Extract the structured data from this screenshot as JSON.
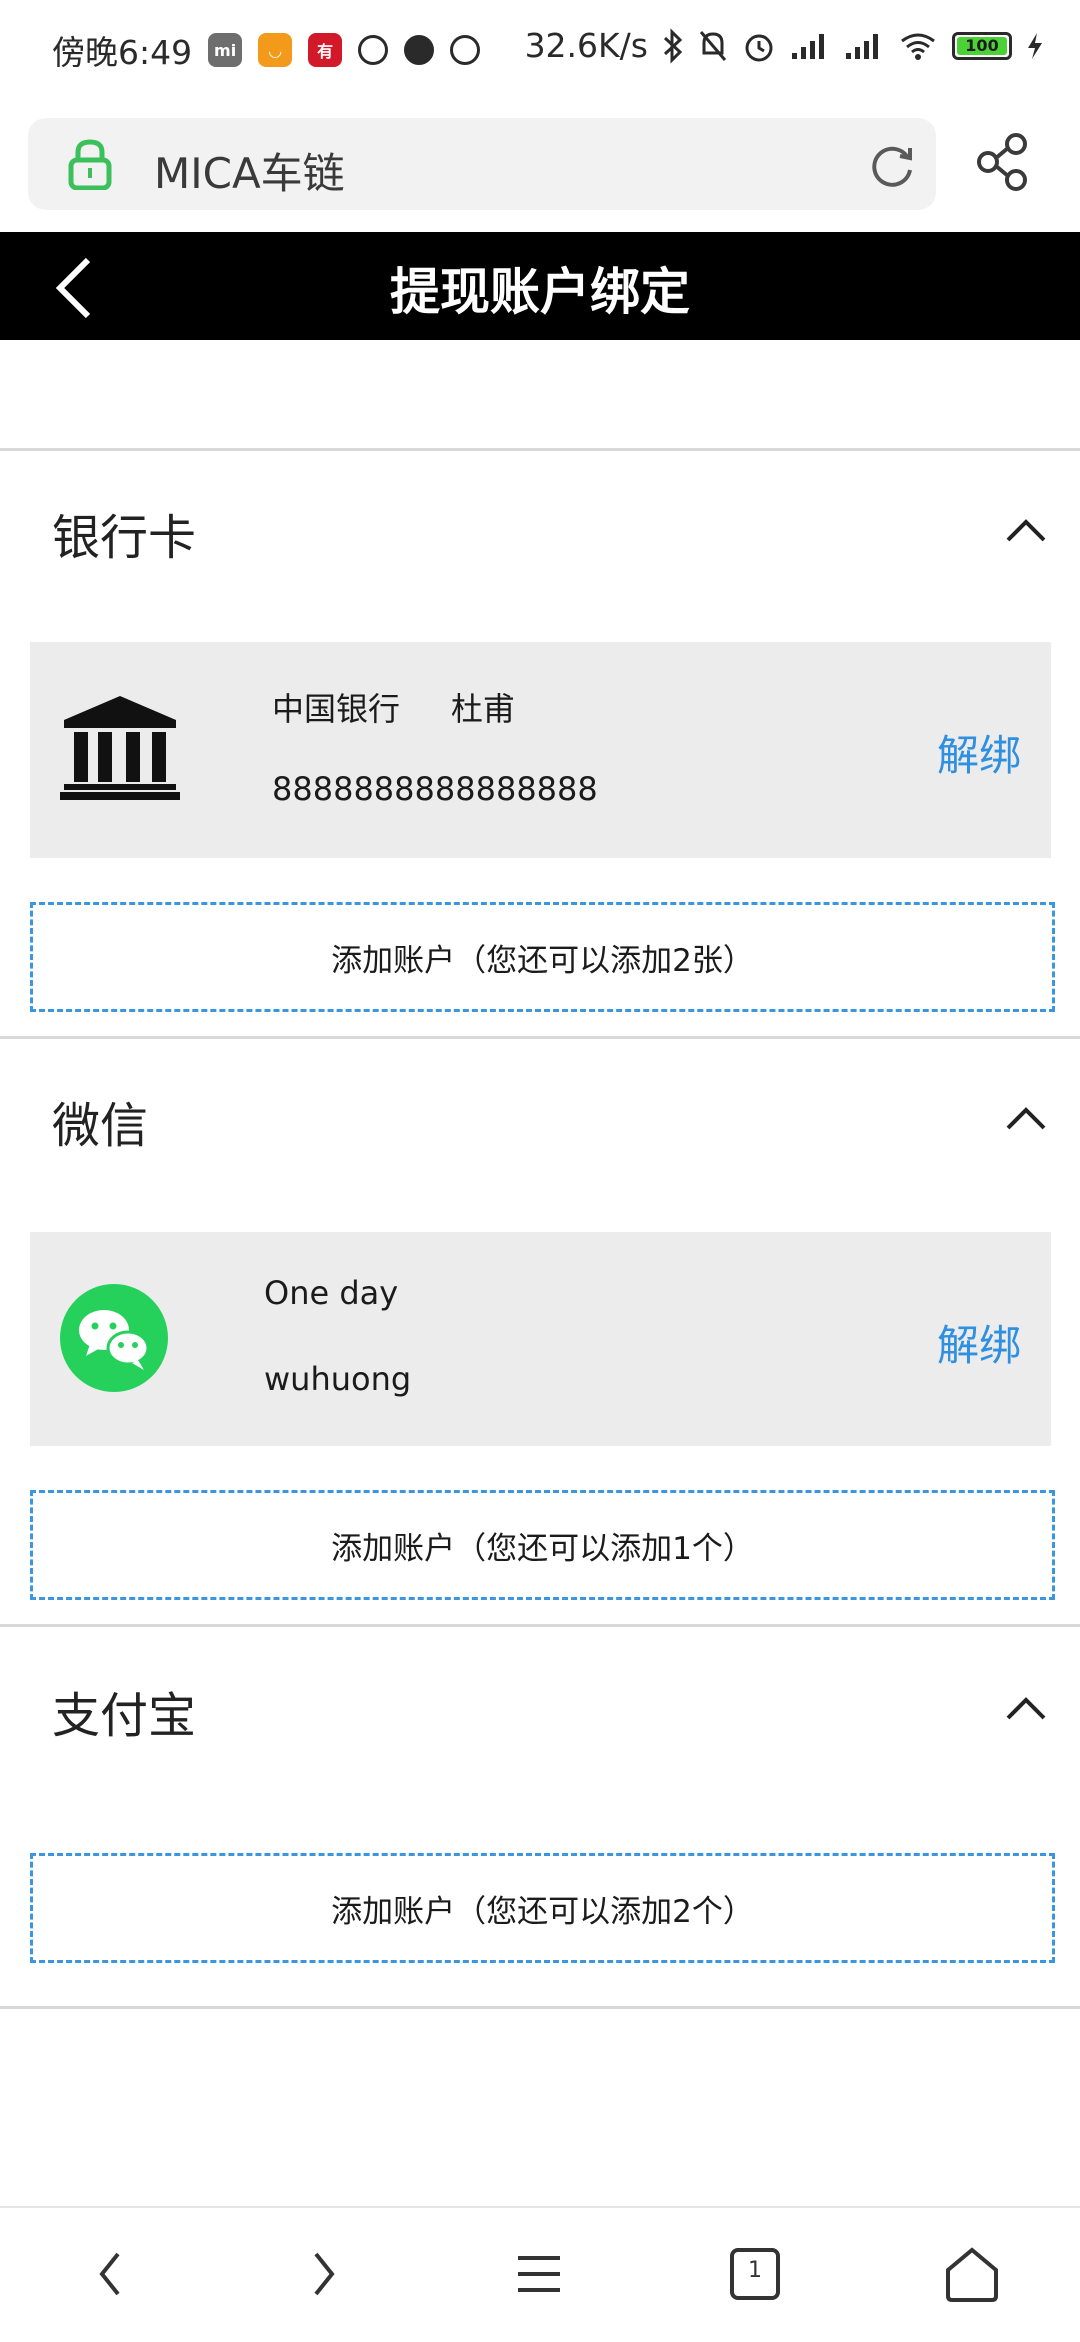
{
  "status_bar": {
    "time": "傍晚6:49",
    "network_speed": "32.6K/s",
    "battery": "100",
    "apps": [
      "mi",
      "taobao",
      "youpin"
    ]
  },
  "browser": {
    "url_title": "MICA车链",
    "lock_icon": "lock-icon",
    "refresh_icon": "refresh-icon",
    "share_icon": "share-icon"
  },
  "header": {
    "title": "提现账户绑定",
    "back_icon": "chevron-left-icon"
  },
  "sections": {
    "bank": {
      "title": "银行卡",
      "card": {
        "line1": "中国银行     杜甫",
        "line2": "8888888888888888",
        "unbind_label": "解绑"
      },
      "add_label": "添加账户（您还可以添加2张）"
    },
    "wechat": {
      "title": "微信",
      "card": {
        "line1": "One day",
        "line2": "wuhuong",
        "unbind_label": "解绑"
      },
      "add_label": "添加账户（您还可以添加1个）"
    },
    "alipay": {
      "title": "支付宝",
      "add_label": "添加账户（您还可以添加2个）"
    }
  },
  "bottom_nav": {
    "tab_count": "1"
  },
  "colors": {
    "accent": "#2f8fe0",
    "header_bg": "#000000",
    "card_bg": "#ececec",
    "wechat_green": "#25d15a",
    "lock_green": "#3cc05b"
  }
}
